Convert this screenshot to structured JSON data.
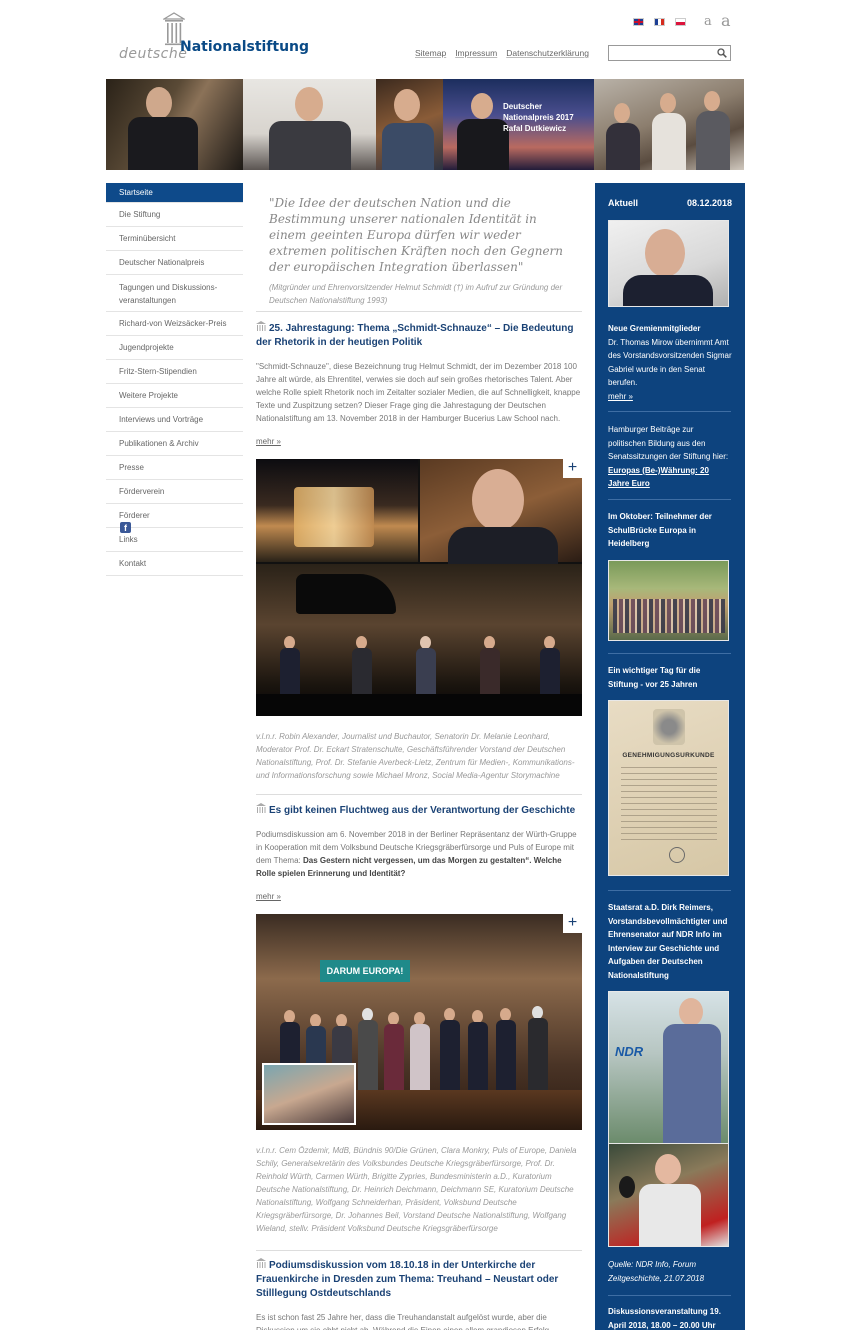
{
  "header": {
    "logo_word1": "deutsche",
    "logo_word2": "Nationalstiftung",
    "languages": [
      "English",
      "Français",
      "Polski"
    ],
    "font_small": "a",
    "font_large": "a",
    "links": [
      "Sitemap",
      "Impressum",
      "Datenschutzerklärung"
    ],
    "search_placeholder": ""
  },
  "banner": {
    "caption_line1": "Deutscher Nationalpreis 2017",
    "caption_line2": "Rafal Dutkiewicz"
  },
  "nav": {
    "items": [
      "Startseite",
      "Die Stiftung",
      "Terminübersicht",
      "Deutscher Nationalpreis",
      "Tagungen und Diskussions-veranstaltungen",
      "Richard-von Weizsäcker-Preis",
      "Jugendprojekte",
      "Fritz-Stern-Stipendien",
      "Weitere Projekte",
      "Interviews und Vorträge",
      "Publikationen & Archiv",
      "Presse",
      "Förderverein",
      "Förderer",
      "Links",
      "Kontakt"
    ],
    "social": "f"
  },
  "main": {
    "quote": "\"Die Idee der deutschen Nation und die Bestimmung unserer nationalen Identität in einem geeinten Europa dürfen wir weder extremen politischen Kräften noch den Gegnern der europäischen Integration überlassen\"",
    "quote_source": "(Mitgründer und Ehrenvorsitzender Helmut Schmidt (†) im Aufruf zur Gründung der Deutschen Nationalstiftung 1993)",
    "article1": {
      "title": "25. Jahrestagung: Thema „Schmidt-Schnauze“ – Die Bedeutung der Rhetorik in der heutigen Politik",
      "text": "\"Schmidt-Schnauze\", diese Bezeichnung trug Helmut Schmidt, der im Dezember 2018 100 Jahre alt würde, als Ehrentitel, verwies sie doch auf sein großes rhetorisches Talent. Aber welche Rolle spielt Rhetorik noch im Zeitalter sozialer Medien, die auf Schnelligkeit, knappe Texte und Zuspitzung setzen? Dieser Frage ging die Jahrestagung der Deutschen Nationalstiftung am 13. November 2018 in der Hamburger Bucerius Law School nach.",
      "more": "mehr »",
      "caption": "v.l.n.r. Robin Alexander, Journalist und Buchautor, Senatorin Dr. Melanie Leonhard, Moderator Prof. Dr. Eckart Stratenschulte, Geschäftsführender Vorstand der Deutschen Nationalstiftung, Prof. Dr. Stefanie Averbeck-Lietz, Zentrum für Medien-, Kommunikations- und Informationsforschung sowie Michael Mronz, Social Media-Agentur Storymachine"
    },
    "article2": {
      "title": "Es gibt keinen Fluchtweg aus der Verantwortung der Geschichte",
      "text": "Podiumsdiskussion am 6. November 2018 in der Berliner Repräsentanz der Würth-Gruppe in Kooperation mit dem Volksbund Deutsche Kriegsgräberfürsorge und Puls of Europe mit dem Thema:",
      "text_bold": "Das Gestern nicht vergessen, um das Morgen zu gestalten“. Welche Rolle spielen Erinnerung und Identität?",
      "more": "mehr »",
      "banner_text": "DARUM EUROPA!",
      "caption": "v.l.n.r. Cem Özdemir, MdB, Bündnis 90/Die Grünen, Clara Monkry, Puls of Europe, Daniela Schily, Generalsekretärin des Volksbundes Deutsche Kriegsgräberfürsorge, Prof. Dr. Reinhold Würth, Carmen Würth, Brigitte Zypries, Bundesministerin a.D., Kuratorium Deutsche Nationalstiftung, Dr. Heinrich Deichmann, Deichmann SE, Kuratorium Deutsche Nationalstiftung, Wolfgang Schneiderhan, Präsident, Volksbund Deutsche Kriegsgräberfürsorge, Dr. Johannes Beil, Vorstand Deutsche Nationalstiftung, Wolfgang Wieland, stellv. Präsident Volksbund Deutsche Kriegsgräberfürsorge"
    },
    "article3": {
      "title": "Podiumsdiskussion vom 18.10.18 in der Unterkirche der Frauenkirche in Dresden zum Thema: Treuhand – Neustart oder Stilllegung Ostdeutschlands",
      "text": "Es ist schon fast 25 Jahre her, dass die Treuhandanstalt aufgelöst wurde, aber die Diskussion um sie ebbt nicht ab. Während die Einen einen allem grandiosen Erfolg"
    },
    "plus": "+"
  },
  "aside": {
    "title": "Aktuell",
    "date": "08.12.2018",
    "item1_title": "Neue Gremienmitglieder",
    "item1_text": "Dr. Thomas Mirow übernimmt Amt des Vorstandsvorsitzenden Sigmar Gabriel wurde in den Senat berufen.",
    "item1_more": "mehr »",
    "item2_text": "Hamburger Beiträge zur politischen Bildung aus den Senatssitzungen der Stiftung hier:",
    "item2_link": "Europas (Be-)Währung: 20 Jahre Euro",
    "item3_title": "Im Oktober: Teilnehmer der SchulBrücke Europa in Heidelberg",
    "item4_title": "Ein wichtiger Tag für die Stiftung - vor 25 Jahren",
    "doc_title": "GENEHMIGUNGSURKUNDE",
    "item5_title": "Staatsrat a.D. Dirk Reimers, Vorstandsbevollmächtigter und Ehrensenator auf NDR Info im Interview zur Geschichte und Aufgaben der Deutschen Nationalstiftung",
    "ndr_logo": "NDR",
    "item5_source": "Quelle: NDR Info, Forum Zeitgeschichte, 21.07.2018",
    "item6_title": "Diskussionsveranstaltung 19. April 2018, 18.00 – 20.00 Uhr"
  }
}
